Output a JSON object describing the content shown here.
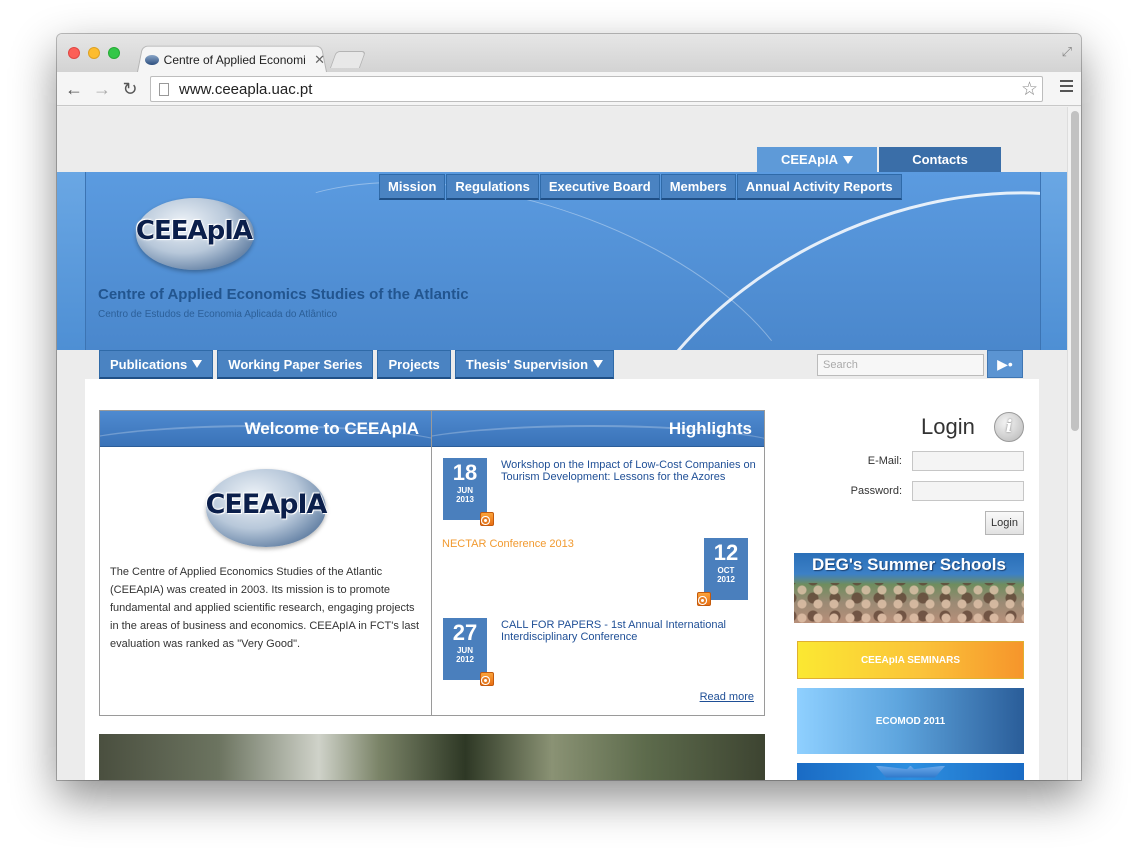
{
  "browser": {
    "tab_title": "Centre of Applied Economi",
    "url": "www.ceeapla.uac.pt"
  },
  "top_tabs": [
    "CEEApIA",
    "Contacts"
  ],
  "main_nav": [
    "Mission",
    "Regulations",
    "Executive Board",
    "Members",
    "Annual Activity Reports"
  ],
  "logo_text": "CEEApIA",
  "site": {
    "title": "Centre of Applied Economics Studies of the Atlantic",
    "subtitle": "Centro de Estudos de Economia Aplicada do Atlântico"
  },
  "secondary_nav": [
    "Publications",
    "Working Paper Series",
    "Projects",
    "Thesis' Supervision"
  ],
  "search": {
    "placeholder": "Search"
  },
  "welcome": {
    "title": "Welcome to CEEApIA",
    "text": "The Centre of Applied Economics Studies of the Atlantic (CEEApIA) was created in 2003. Its mission is to promote fundamental and applied scientific research, engaging projects in the areas of business and economics. CEEApIA in FCT's last evaluation was ranked as \"Very Good\"."
  },
  "highlights": {
    "title": "Highlights",
    "items": [
      {
        "day": "18",
        "month": "JUN",
        "year": "2013",
        "title": "Workshop on the Impact of Low-Cost Companies on Tourism Development: Lessons for the Azores"
      },
      {
        "day": "12",
        "month": "OCT",
        "year": "2012",
        "title": "NECTAR Conference 2013"
      },
      {
        "day": "27",
        "month": "JUN",
        "year": "2012",
        "title": "CALL FOR PAPERS - 1st Annual International Interdisciplinary Conference"
      }
    ],
    "read_more": "Read more"
  },
  "login": {
    "title": "Login",
    "email_label": "E-Mail:",
    "password_label": "Password:",
    "button": "Login"
  },
  "side_banners": {
    "summer_schools": "DEG's Summer Schools",
    "seminars": "CEEApIA SEMINARS",
    "ecomod": "ECOMOD 2011"
  }
}
